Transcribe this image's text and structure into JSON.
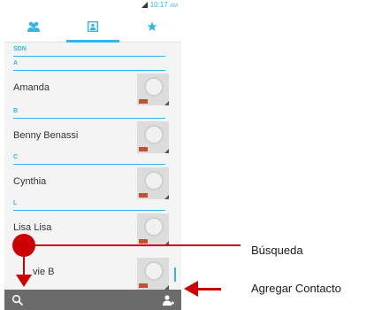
{
  "status_bar": {
    "time": "10:17",
    "ampm": "AM"
  },
  "tabs": [
    {
      "icon": "group-icon",
      "selected": false
    },
    {
      "icon": "contact-card-icon",
      "selected": true
    },
    {
      "icon": "star-icon",
      "selected": false
    }
  ],
  "sections": [
    {
      "label": "SDN"
    },
    {
      "label": "A"
    },
    {
      "label": "B"
    },
    {
      "label": "C"
    },
    {
      "label": "L"
    }
  ],
  "contacts": [
    {
      "name": "Amanda"
    },
    {
      "name": "Benny Benassi"
    },
    {
      "name": "Cynthia"
    },
    {
      "name": "Lisa Lisa"
    },
    {
      "name": "vie B"
    }
  ],
  "bottom_bar": {
    "left_icon": "search-icon",
    "right_icon": "add-contact-icon"
  },
  "callouts": {
    "search": "Búsqueda",
    "add_contact": "Agregar Contacto"
  },
  "colors": {
    "accent": "#33b5e5",
    "annotation": "#cc0000",
    "bottom_bar": "#6b6b6b"
  }
}
